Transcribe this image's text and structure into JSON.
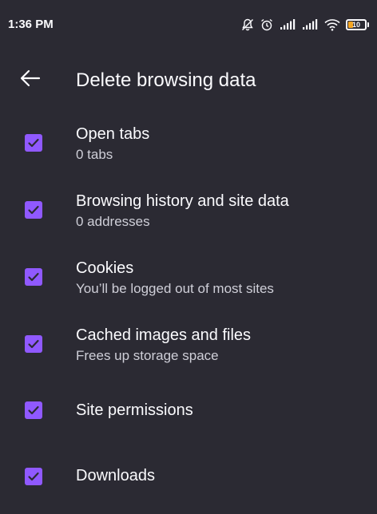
{
  "status_bar": {
    "time": "1:36 PM",
    "battery_level": "10"
  },
  "toolbar": {
    "title": "Delete browsing data"
  },
  "options": [
    {
      "title": "Open tabs",
      "subtitle": "0 tabs",
      "checked": true
    },
    {
      "title": "Browsing history and site data",
      "subtitle": "0 addresses",
      "checked": true
    },
    {
      "title": "Cookies",
      "subtitle": "You’ll be logged out of most sites",
      "checked": true
    },
    {
      "title": "Cached images and files",
      "subtitle": "Frees up storage space",
      "checked": true
    },
    {
      "title": "Site permissions",
      "subtitle": "",
      "checked": true
    },
    {
      "title": "Downloads",
      "subtitle": "",
      "checked": true
    }
  ],
  "colors": {
    "background": "#2b2a33",
    "checkbox": "#9059ff",
    "text": "#fbfbfe",
    "secondary_text": "#cfcfd8"
  }
}
